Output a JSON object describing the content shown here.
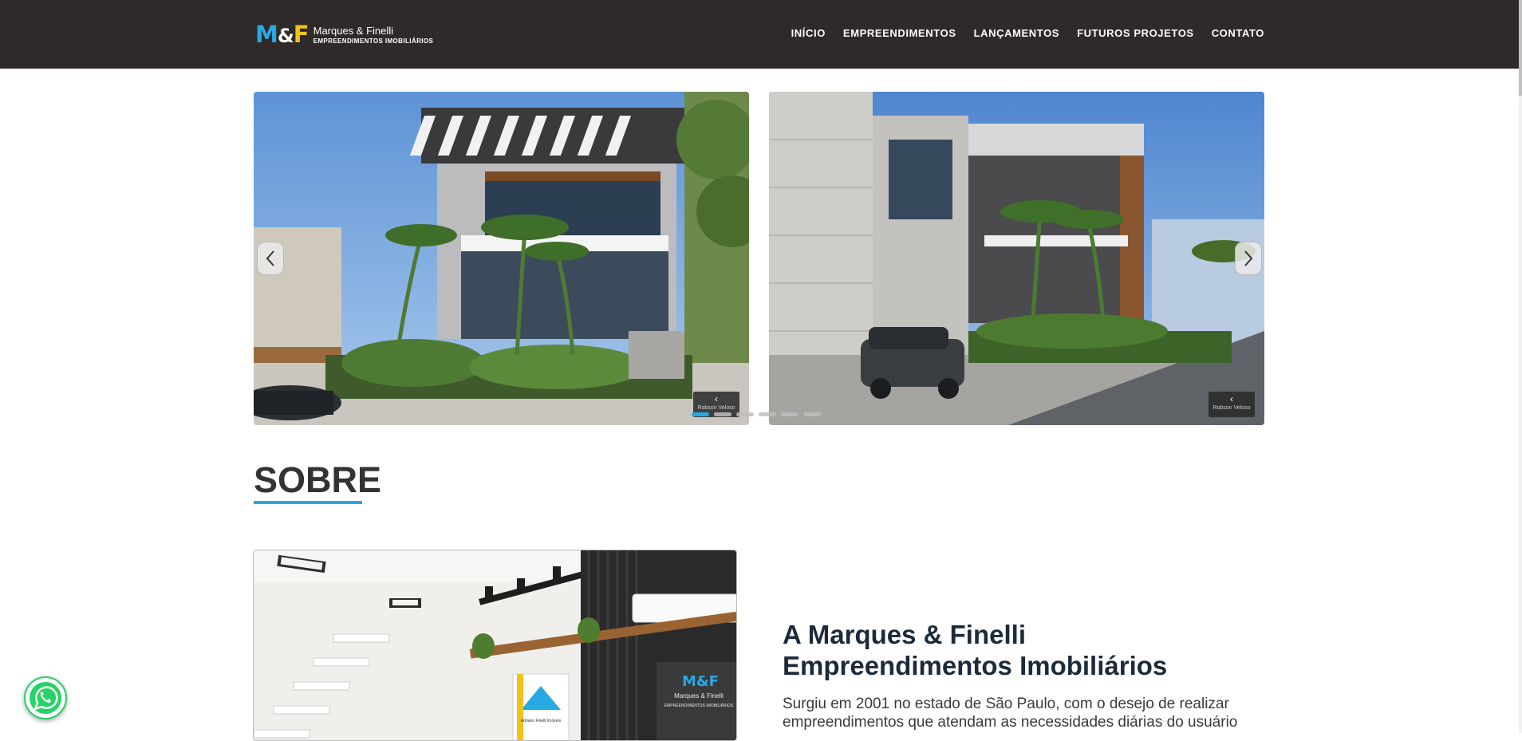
{
  "brand": {
    "mark_m": "M",
    "mark_amp": "&",
    "mark_f": "F",
    "name": "Marques & Finelli",
    "tagline": "EMPREENDIMENTOS IMOBILIÁRIOS",
    "colors": {
      "header_bg": "#2e2a29",
      "accent_blue": "#27a9e1",
      "accent_yellow": "#f2c21b"
    }
  },
  "nav": {
    "items": [
      {
        "label": "INÍCIO"
      },
      {
        "label": "EMPREENDIMENTOS"
      },
      {
        "label": "LANÇAMENTOS"
      },
      {
        "label": "FUTUROS PROJETOS"
      },
      {
        "label": "CONTATO"
      }
    ]
  },
  "carousel": {
    "slides": [
      {
        "image": "modern-house-render-front",
        "watermark": "Robson Veloso"
      },
      {
        "image": "modern-house-render-side",
        "watermark": "Robson Veloso"
      }
    ],
    "prev_icon": "chevron-left-icon",
    "next_icon": "chevron-right-icon",
    "dots_total": 6,
    "active_dot": 1
  },
  "about": {
    "section_title": "SOBRE",
    "heading": "A Marques & Finelli Empreendimentos Imobiliários",
    "text": "Surgiu em 2001 no estado de São Paulo, com o desejo de realizar empreendimentos que atendam as necessidades diárias do usuário",
    "image": "office-interior-render",
    "sign_mark": "M&F",
    "sign_name": "Marques & Finelli",
    "sign_sub": "EMPREENDIMENTOS IMOBILIÁRIOS",
    "board_text": "Adriano Finelli Imóveis"
  },
  "whatsapp": {
    "icon": "whatsapp-icon",
    "color": "#25d366"
  }
}
